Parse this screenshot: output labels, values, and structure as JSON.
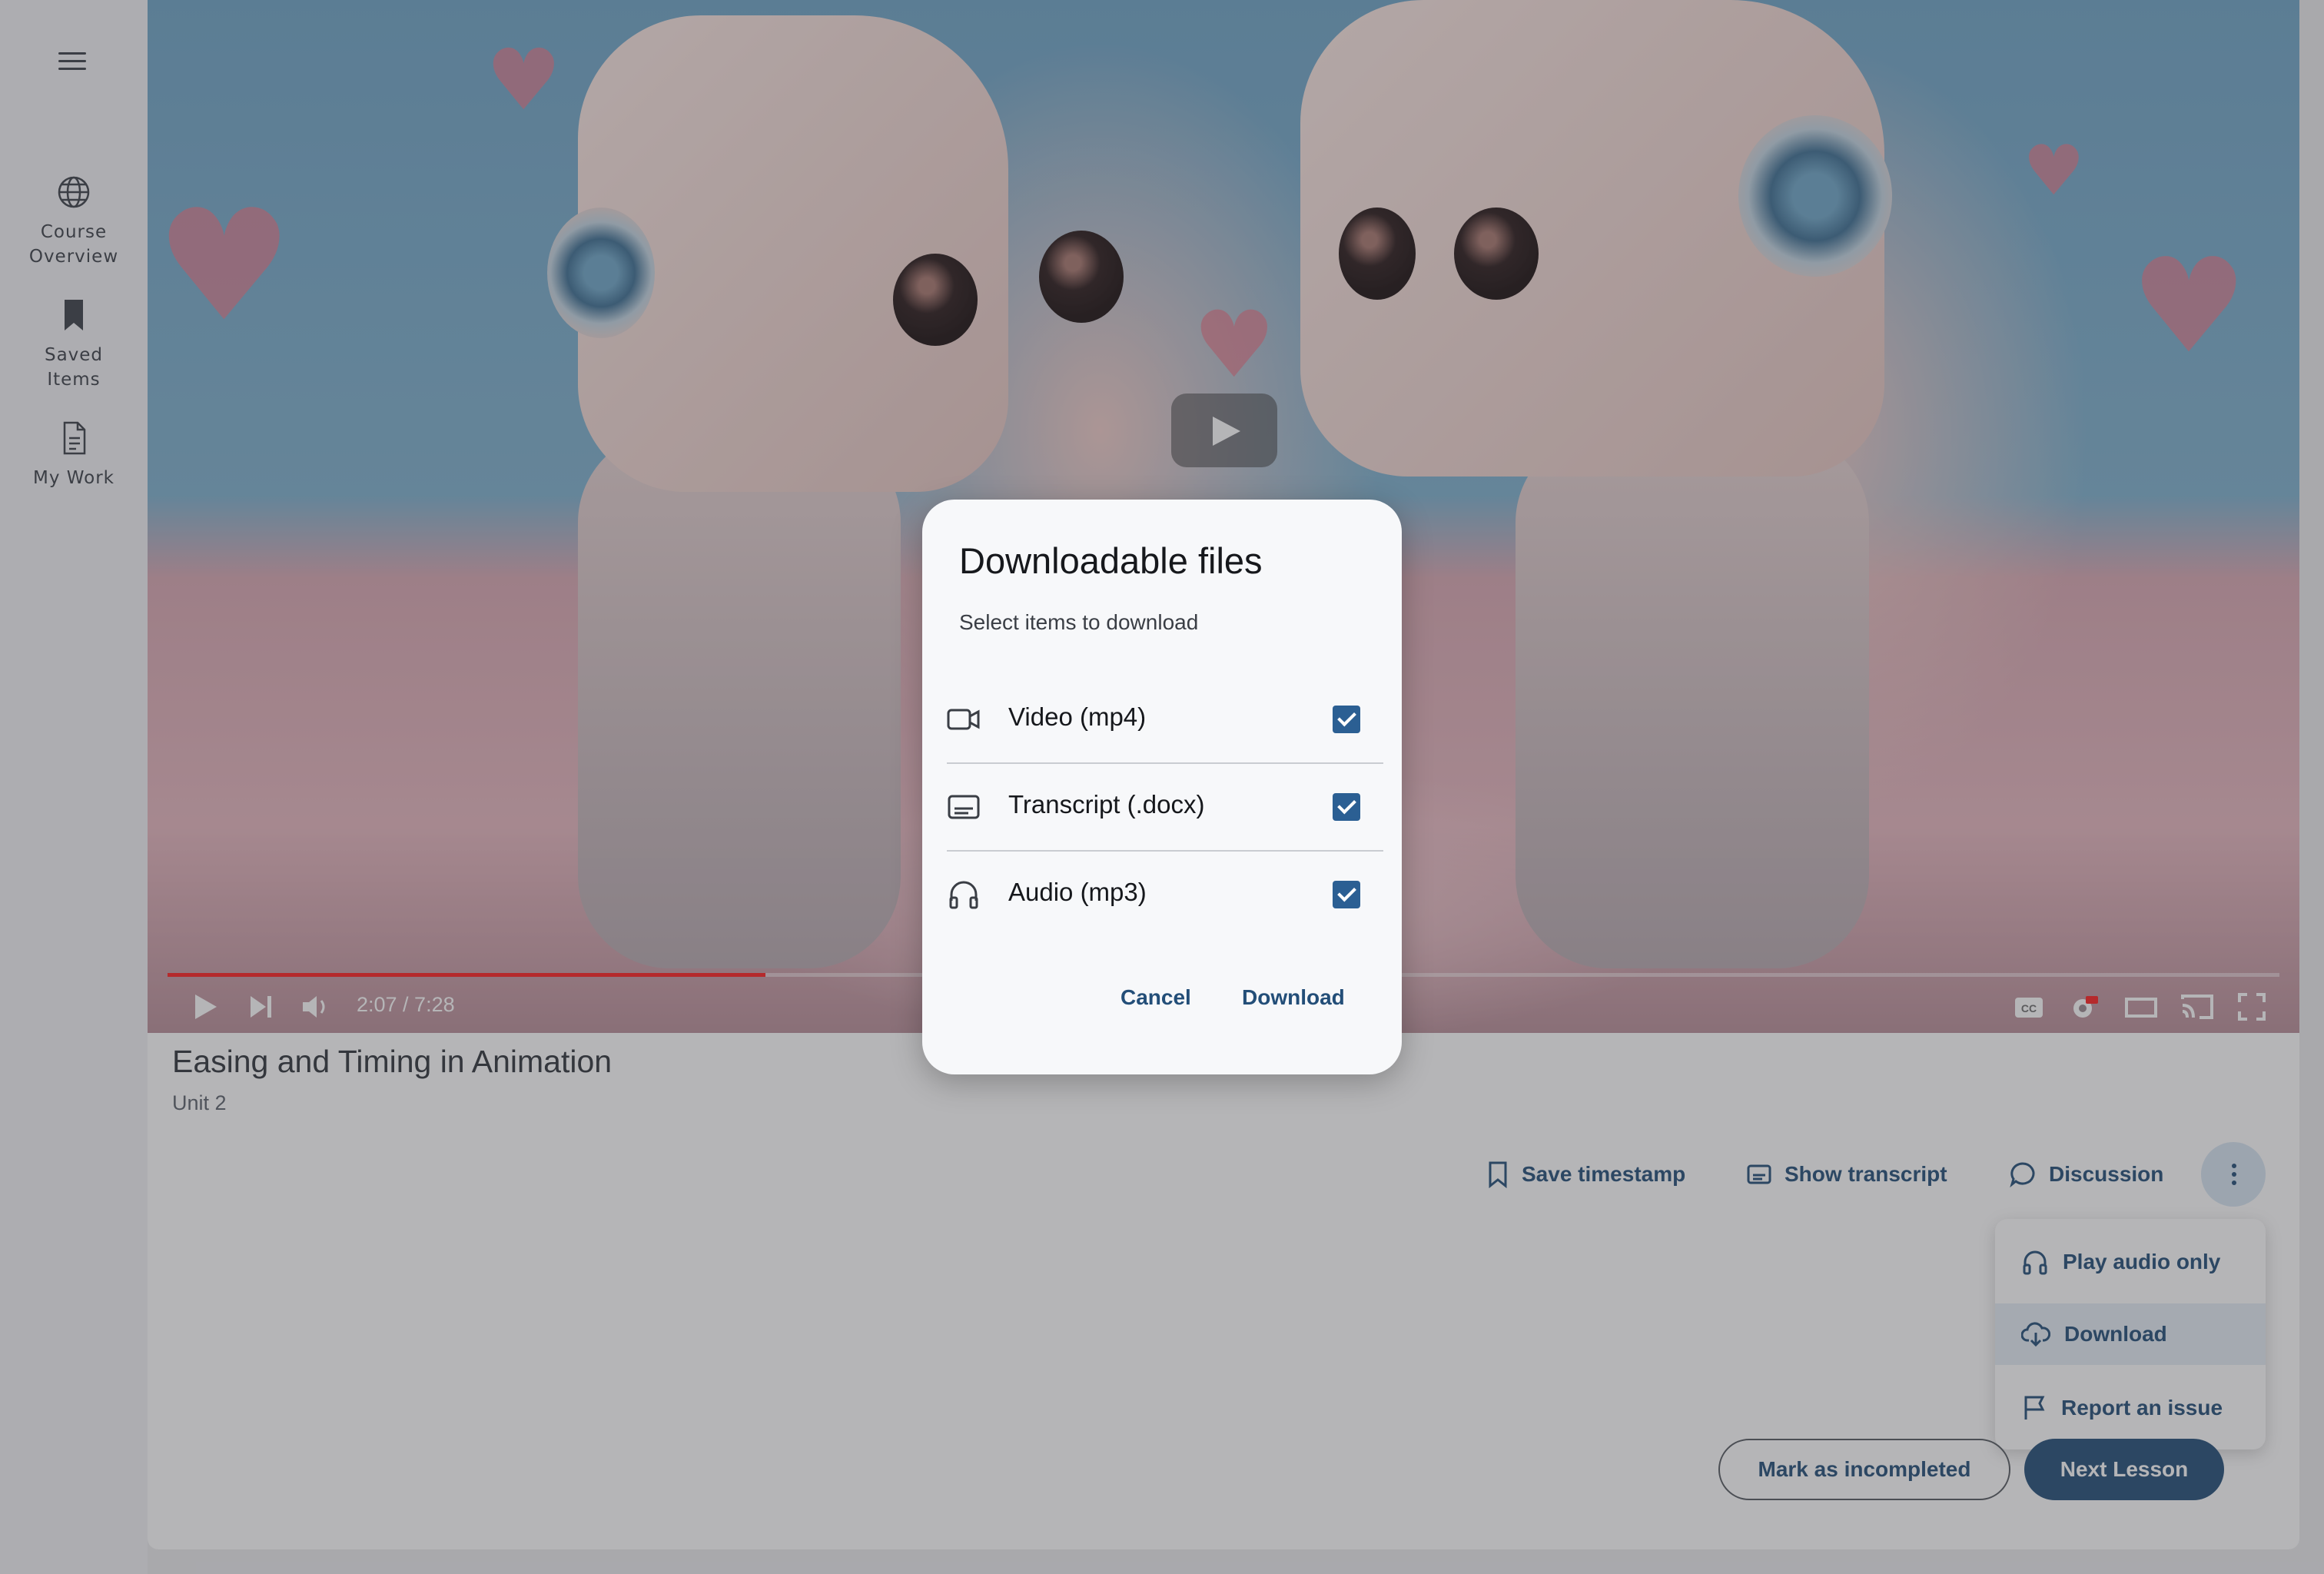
{
  "nav": {
    "items": [
      {
        "label_line1": "Course",
        "label_line2": "Overview",
        "icon": "globe-icon"
      },
      {
        "label_line1": "Saved",
        "label_line2": "Items",
        "icon": "bookmark-icon"
      },
      {
        "label_line1": "My Work",
        "label_line2": "",
        "icon": "document-icon"
      }
    ]
  },
  "player": {
    "time": "2:07 / 7:28",
    "progress_fraction": 0.283
  },
  "lesson": {
    "title": "Easing and Timing in Animation",
    "unit": "Unit 2"
  },
  "actions": {
    "save_timestamp": "Save timestamp",
    "show_transcript": "Show transcript",
    "discussion": "Discussion"
  },
  "more_menu": {
    "items": [
      {
        "label": "Play audio only",
        "icon": "headphones-icon"
      },
      {
        "label": "Download",
        "icon": "cloud-download-icon"
      },
      {
        "label": "Report an issue",
        "icon": "flag-icon"
      }
    ]
  },
  "footer": {
    "mark_incomplete": "Mark as incompleted",
    "next_lesson": "Next Lesson"
  },
  "modal": {
    "title": "Downloadable files",
    "hint": "Select items to download",
    "files": [
      {
        "label": "Video (mp4)",
        "checked": true
      },
      {
        "label": "Transcript (.docx)",
        "checked": true
      },
      {
        "label": "Audio (mp3)",
        "checked": true
      }
    ],
    "cancel": "Cancel",
    "download": "Download"
  },
  "colors": {
    "accent": "#234e78",
    "checkbox": "#2b5f93",
    "progress": "#ff1f1f"
  }
}
